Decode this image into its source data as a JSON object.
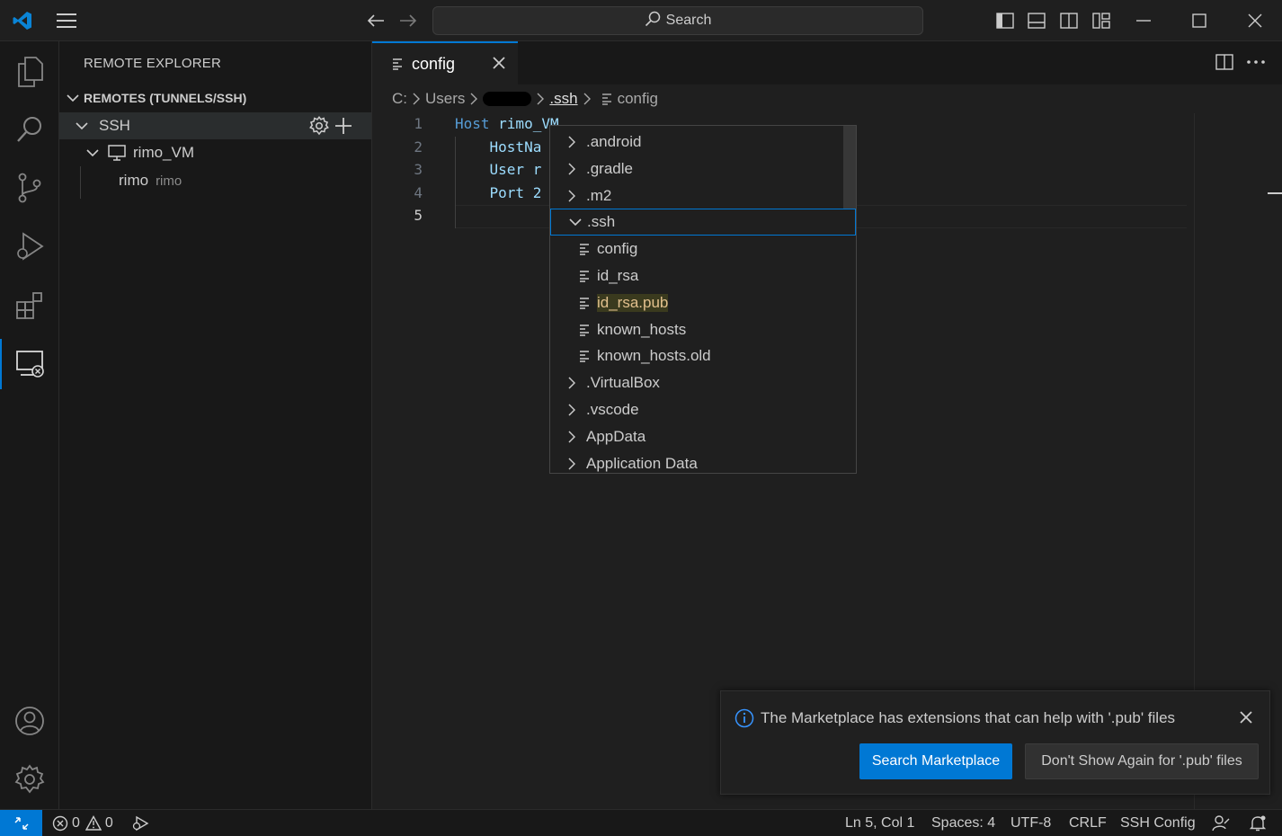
{
  "titlebar": {
    "search_label": "Search"
  },
  "sidebar": {
    "title": "REMOTE EXPLORER",
    "section": "REMOTES (TUNNELS/SSH)",
    "ssh_group": "SSH",
    "host": "rimo_VM",
    "user_label": "rimo",
    "user_description": "rimo"
  },
  "tabs": [
    {
      "label": "config"
    }
  ],
  "breadcrumb": {
    "drive": "C:",
    "users": "Users",
    "ssh": ".ssh",
    "file": "config"
  },
  "editor": {
    "line_numbers": [
      "1",
      "2",
      "3",
      "4",
      "5"
    ],
    "lines": [
      {
        "kw": "Host",
        "rest": " rimo_VM"
      },
      {
        "kw": "",
        "rest": "    HostNa"
      },
      {
        "kw": "",
        "rest": "    User r"
      },
      {
        "kw": "",
        "rest": "    Port 2"
      },
      {
        "kw": "",
        "rest": ""
      }
    ]
  },
  "dropdown": {
    "items": [
      {
        "label": ".android",
        "kind": "folder-collapsed"
      },
      {
        "label": ".gradle",
        "kind": "folder-collapsed"
      },
      {
        "label": ".m2",
        "kind": "folder-collapsed"
      },
      {
        "label": ".ssh",
        "kind": "folder-expanded"
      },
      {
        "label": "config",
        "kind": "file"
      },
      {
        "label": "id_rsa",
        "kind": "file"
      },
      {
        "label": "id_rsa.pub",
        "kind": "file-highlighted"
      },
      {
        "label": "known_hosts",
        "kind": "file"
      },
      {
        "label": "known_hosts.old",
        "kind": "file"
      },
      {
        "label": ".VirtualBox",
        "kind": "folder-collapsed"
      },
      {
        "label": ".vscode",
        "kind": "folder-collapsed"
      },
      {
        "label": "AppData",
        "kind": "folder-collapsed"
      },
      {
        "label": "Application Data",
        "kind": "folder-collapsed"
      }
    ]
  },
  "notification": {
    "message": "The Marketplace has extensions that can help with '.pub' files",
    "primary_button": "Search Marketplace",
    "secondary_button": "Don't Show Again for '.pub' files"
  },
  "statusbar": {
    "errors": "0",
    "warnings": "0",
    "position": "Ln 5, Col 1",
    "spaces": "Spaces: 4",
    "encoding": "UTF-8",
    "eol": "CRLF",
    "language": "SSH Config"
  },
  "colors": {
    "accent": "#0078d4",
    "highlight_text": "#e2c08d",
    "background": "#1f1f1f"
  }
}
